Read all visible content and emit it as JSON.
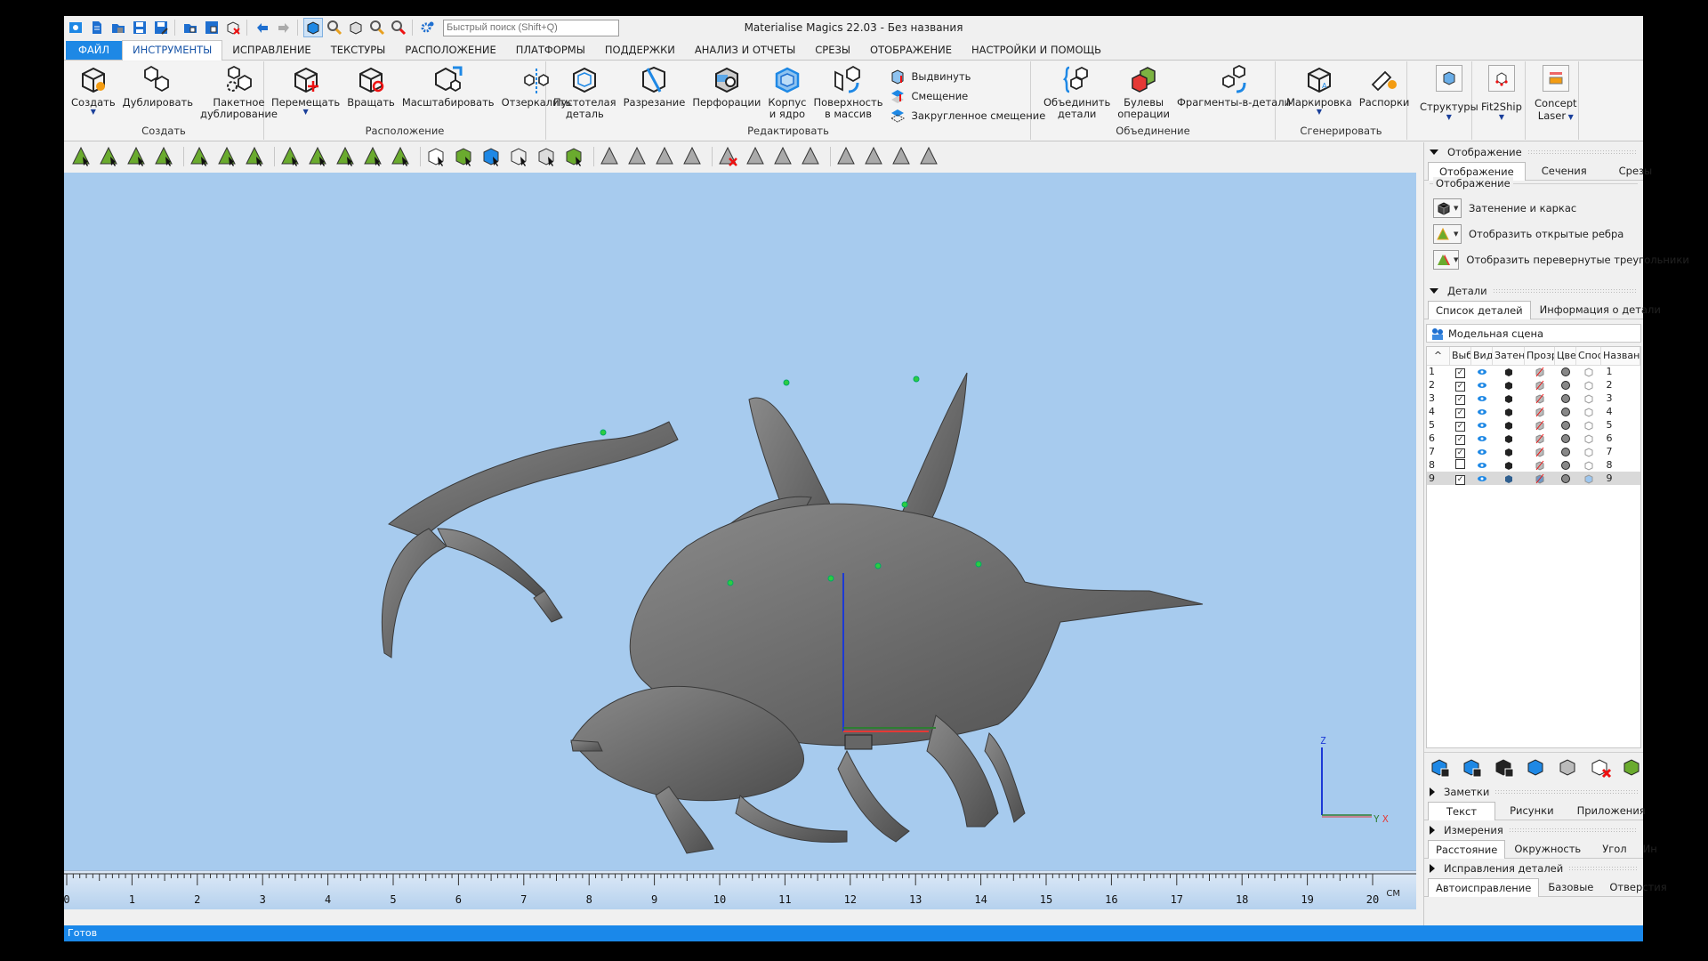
{
  "app": {
    "title": "Materialise Magics 22.03 - Без названия",
    "quick_search_placeholder": "Быстрый поиск (Shift+Q)"
  },
  "menu_tabs": [
    {
      "label": "ФАЙЛ",
      "kind": "file"
    },
    {
      "label": "ИНСТРУМЕНТЫ",
      "kind": "active"
    },
    {
      "label": "ИСПРАВЛЕНИЕ"
    },
    {
      "label": "ТЕКСТУРЫ"
    },
    {
      "label": "РАСПОЛОЖЕНИЕ"
    },
    {
      "label": "ПЛАТФОРМЫ"
    },
    {
      "label": "ПОДДЕРЖКИ"
    },
    {
      "label": "АНАЛИЗ И ОТЧЕТЫ"
    },
    {
      "label": "СРЕЗЫ"
    },
    {
      "label": "ОТОБРАЖЕНИЕ"
    },
    {
      "label": "НАСТРОЙКИ И ПОМОЩЬ"
    }
  ],
  "ribbon": {
    "create": {
      "label": "Создать",
      "buttons": [
        {
          "label": "Создать",
          "dropdown": true
        },
        {
          "label": "Дублировать"
        },
        {
          "label": "Пакетное\nдублирование"
        }
      ]
    },
    "placement": {
      "label": "Расположение",
      "buttons": [
        {
          "label": "Перемещать",
          "dropdown": true
        },
        {
          "label": "Вращать"
        },
        {
          "label": "Масштабировать"
        },
        {
          "label": "Отзеркалить"
        }
      ]
    },
    "edit": {
      "label": "Редактировать",
      "buttons": [
        {
          "label": "Пустотелая\nдеталь"
        },
        {
          "label": "Разрезание"
        },
        {
          "label": "Перфорации"
        },
        {
          "label": "Корпус\nи ядро"
        },
        {
          "label": "Поверхность\nв массив"
        }
      ],
      "small_buttons": [
        {
          "label": "Выдвинуть"
        },
        {
          "label": "Смещение"
        },
        {
          "label": "Закругленное смещение"
        }
      ]
    },
    "merge": {
      "label": "Объединение",
      "buttons": [
        {
          "label": "Объединить\nдетали"
        },
        {
          "label": "Булевы\nоперации",
          "dropdown": true
        },
        {
          "label": "Фрагменты-в-детали"
        }
      ]
    },
    "generate": {
      "label": "Сгенерировать",
      "buttons": [
        {
          "label": "Маркировка",
          "dropdown": true
        },
        {
          "label": "Распорки"
        }
      ]
    },
    "structures": {
      "label": "Структуры"
    },
    "fit2ship": {
      "label": "Fit2Ship"
    },
    "concept": {
      "label": "Concept",
      "label2": "Laser"
    }
  },
  "toolbar2_icons": [
    "mark-triangle-icon",
    "mark-plane-icon",
    "mark-surface-icon",
    "mark-shell-icon",
    "mark-rectangle-icon",
    "mark-contour-icon",
    "mark-curve-icon",
    "mark-window-icon",
    "mark-lasso-icon",
    "mark-fan-icon",
    "mark-sphere-icon",
    "mark-cylinder-icon",
    "select-part-icon",
    "select-shell-icon",
    "select-face-icon",
    "select-wireframe-icon",
    "select-invert-icon",
    "select-all-icon",
    "unmark-triangle-icon",
    "extend-mark-icon",
    "grow-mark-icon",
    "expand-mark-icon",
    "delete-marked-icon",
    "unmark-all-icon",
    "copy-marked-icon",
    "invert-marked-icon",
    "mark-bad-icon",
    "mark-noise-icon",
    "mark-flipped-icon",
    "mark-overlap-icon"
  ],
  "viewport": {
    "background": "#a7cbee",
    "ruler": {
      "ticks": [
        0,
        1,
        2,
        3,
        4,
        5,
        6,
        7,
        8,
        9,
        10,
        11,
        12,
        13,
        14,
        15,
        16,
        17,
        18,
        19,
        20
      ],
      "unit": "СМ"
    },
    "axis_labels": {
      "z": "Z",
      "x": "X",
      "y": "Y"
    }
  },
  "right_panel": {
    "display": {
      "title": "Отображение",
      "tabs": [
        {
          "label": "Отображение",
          "active": true
        },
        {
          "label": "Сечения"
        },
        {
          "label": "Срезы"
        }
      ],
      "group_label": "Отображение",
      "options": [
        {
          "label": "Затенение и каркас",
          "icon": "shaded-wireframe-icon"
        },
        {
          "label": "Отобразить открытые ребра",
          "icon": "open-edges-icon"
        },
        {
          "label": "Отобразить перевернутые треугольники",
          "icon": "flipped-triangles-icon"
        }
      ]
    },
    "details": {
      "title": "Детали",
      "tabs": [
        {
          "label": "Список деталей",
          "active": true
        },
        {
          "label": "Информация о детали"
        }
      ],
      "scene_label": "Модельная сцена",
      "columns": [
        "^",
        "Выбор",
        "Вид",
        "Затенение",
        "Прозрачность",
        "Цвет",
        "Способ",
        "Название"
      ],
      "rows": [
        {
          "n": "1",
          "selected": true,
          "name": "1"
        },
        {
          "n": "2",
          "selected": true,
          "name": "2"
        },
        {
          "n": "3",
          "selected": true,
          "name": "3"
        },
        {
          "n": "4",
          "selected": true,
          "name": "4"
        },
        {
          "n": "5",
          "selected": true,
          "name": "5"
        },
        {
          "n": "6",
          "selected": true,
          "name": "6"
        },
        {
          "n": "7",
          "selected": true,
          "name": "7"
        },
        {
          "n": "8",
          "selected": false,
          "name": "8"
        },
        {
          "n": "9",
          "selected": true,
          "name": "9",
          "highlighted": true
        }
      ],
      "action_icons": [
        "select-all-parts-icon",
        "select-visible-parts-icon",
        "invert-selection-icon",
        "show-parts-icon",
        "hide-parts-icon",
        "delete-parts-icon",
        "color-parts-icon"
      ]
    },
    "notes": {
      "title": "Заметки",
      "tabs": [
        {
          "label": "Текст",
          "active": true
        },
        {
          "label": "Рисунки"
        },
        {
          "label": "Приложения"
        }
      ]
    },
    "measurements": {
      "title": "Измерения",
      "tabs": [
        {
          "label": "Расстояние",
          "active": true
        },
        {
          "label": "Окружность"
        },
        {
          "label": "Угол"
        },
        {
          "label": "Ин"
        }
      ]
    },
    "fixes": {
      "title": "Исправления деталей",
      "tabs": [
        {
          "label": "Автоисправление",
          "active": true
        },
        {
          "label": "Базовые"
        },
        {
          "label": "Отверстия"
        }
      ]
    }
  },
  "status": {
    "text": "Готов"
  },
  "colors": {
    "accent": "#1e88e5",
    "status_bar": "#1a88ea",
    "viewport": "#a7cbee",
    "axis": "#1c39d6"
  }
}
